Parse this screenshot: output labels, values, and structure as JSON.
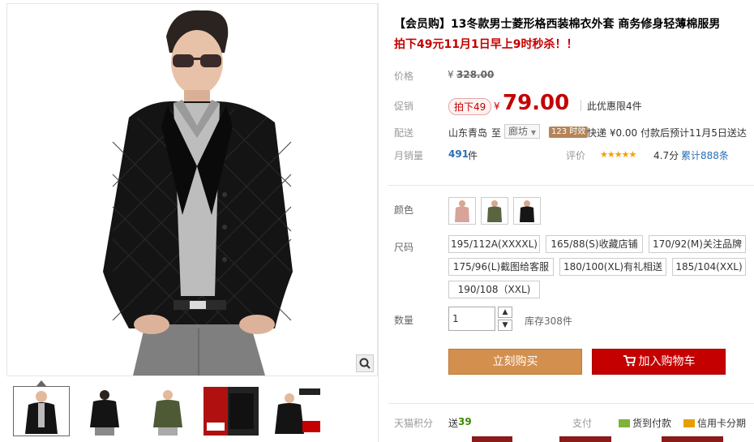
{
  "product": {
    "title": "【会员购】13冬款男士菱形格西装棉衣外套 商务修身轻薄棉服男",
    "promo": "拍下49元11月1日早上9时秒杀！！"
  },
  "price": {
    "label": "价格",
    "currency": "¥",
    "original": "328.00"
  },
  "promotion": {
    "label": "促销",
    "tag": "拍下49",
    "currency": "¥",
    "value": "79.00",
    "limit_text": "此优惠限4件"
  },
  "delivery": {
    "label": "配送",
    "from": "山东青岛",
    "to_word": "至",
    "destination": "廊坊",
    "badge": "123 时效",
    "express": "快递 ¥0.00 付款后预计11月5日送达"
  },
  "sales": {
    "label": "月销量",
    "count": "491",
    "unit": "件",
    "rating_label": "评价",
    "stars": "★★★★★",
    "score": "4.7分",
    "total": "累计888条"
  },
  "color": {
    "label": "颜色",
    "options": [
      "pink-jacket",
      "green-jacket",
      "black-jacket"
    ]
  },
  "size": {
    "label": "尺码",
    "options": [
      "195/112A(XXXXL)",
      "165/88(S)收藏店铺",
      "170/92(M)关注品牌",
      "175/96(L)截图给客服",
      "180/100(XL)有礼相送",
      "185/104(XXL)",
      "190/108（XXL)"
    ]
  },
  "quantity": {
    "label": "数量",
    "value": "1",
    "up": "▲",
    "down": "▼",
    "stock": "库存308件"
  },
  "actions": {
    "buy_now": "立刻购买",
    "add_to_cart": "加入购物车"
  },
  "footer": {
    "points_label": "天猫积分",
    "points_prefix": "送",
    "points_value": "39",
    "pay_label": "支付",
    "cod": "货到付款",
    "credit": "信用卡分期"
  },
  "colors": {
    "accent_red": "#c40000",
    "buy_button": "#d38f4e",
    "cart_button": "#c40000"
  }
}
